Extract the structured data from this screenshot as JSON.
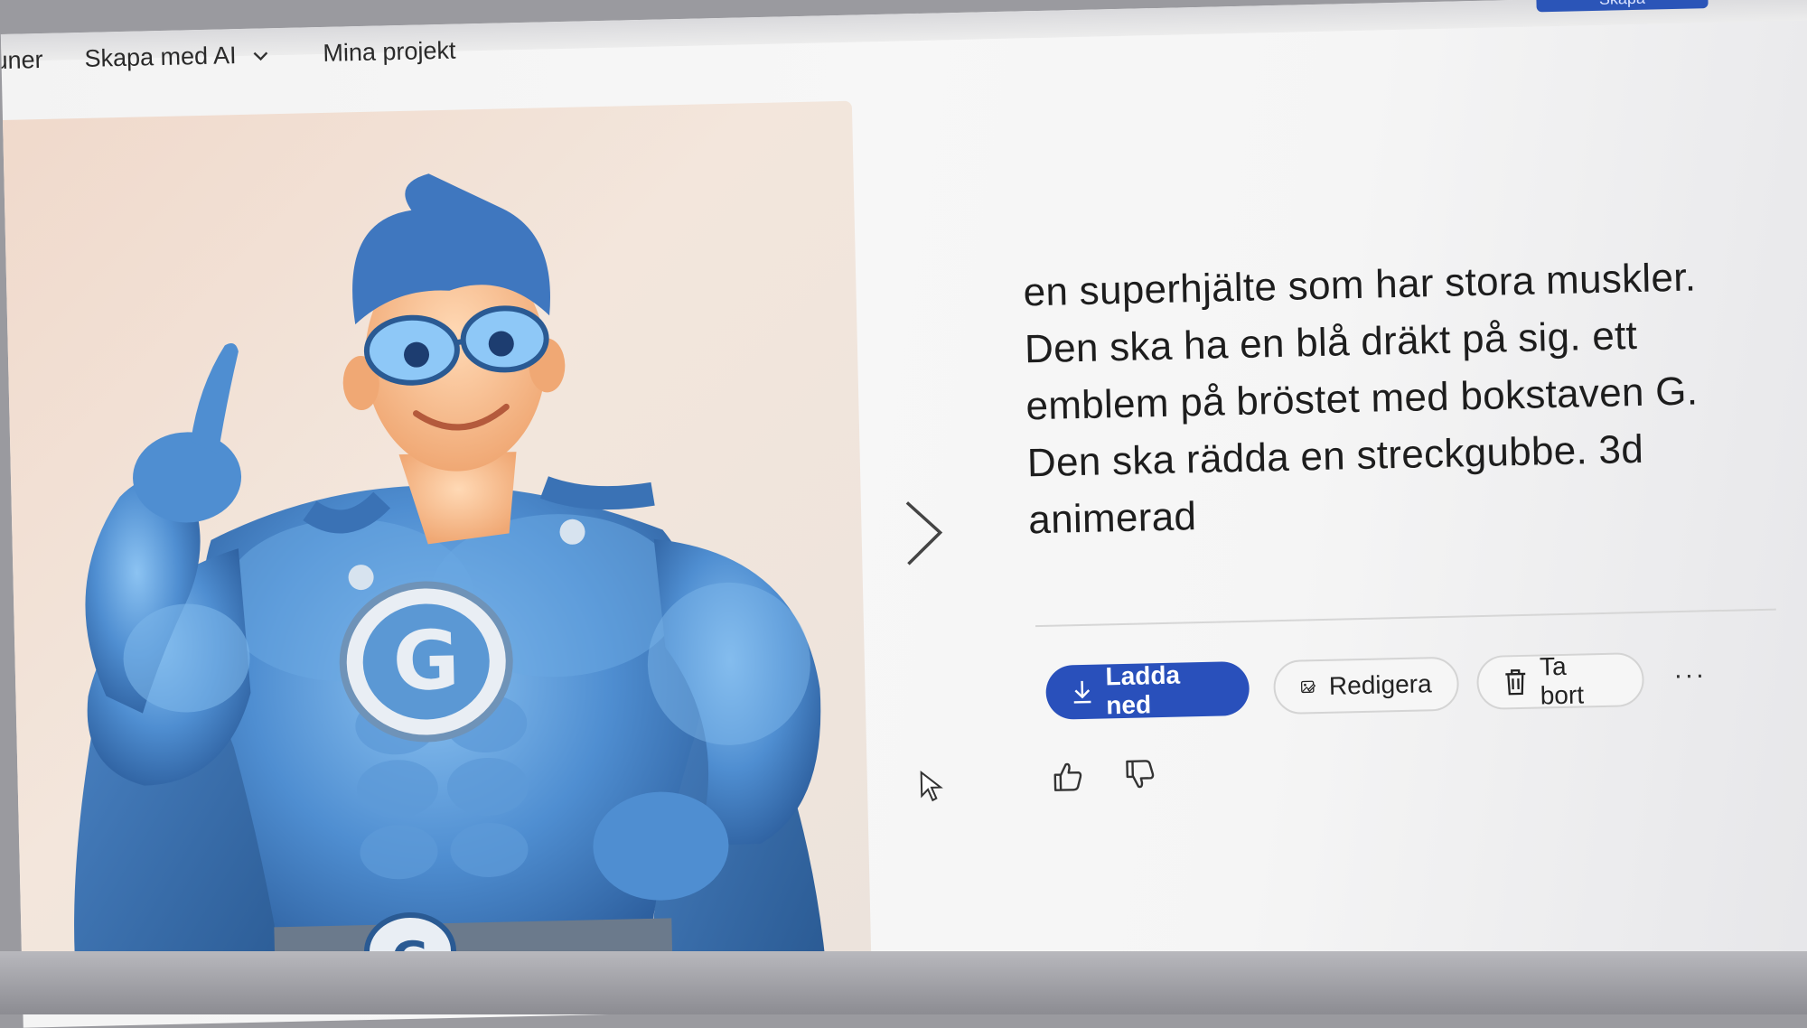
{
  "nav": {
    "items": [
      {
        "label": "uner"
      },
      {
        "label": "Skapa med AI"
      },
      {
        "label": "Mina projekt"
      }
    ],
    "top_button_label": "Skapa"
  },
  "image": {
    "description_icon": "superhero-image",
    "emblem_letter": "G"
  },
  "prompt": {
    "text": "en superhjälte som har stora muskler. Den ska ha en blå dräkt på sig. ett emblem på bröstet med bokstaven G. Den ska rädda en streckgubbe. 3d animerad"
  },
  "actions": {
    "download_label": "Ladda ned",
    "edit_label": "Redigera",
    "delete_label": "Ta bort",
    "more_label": "···"
  },
  "icons": {
    "download": "download-icon",
    "edit": "edit-image-icon",
    "delete": "trash-icon",
    "like": "thumbs-up-icon",
    "dislike": "thumbs-down-icon",
    "next": "chevron-right-icon"
  },
  "colors": {
    "accent": "#2950bb",
    "suit": "#4f8ed1"
  }
}
